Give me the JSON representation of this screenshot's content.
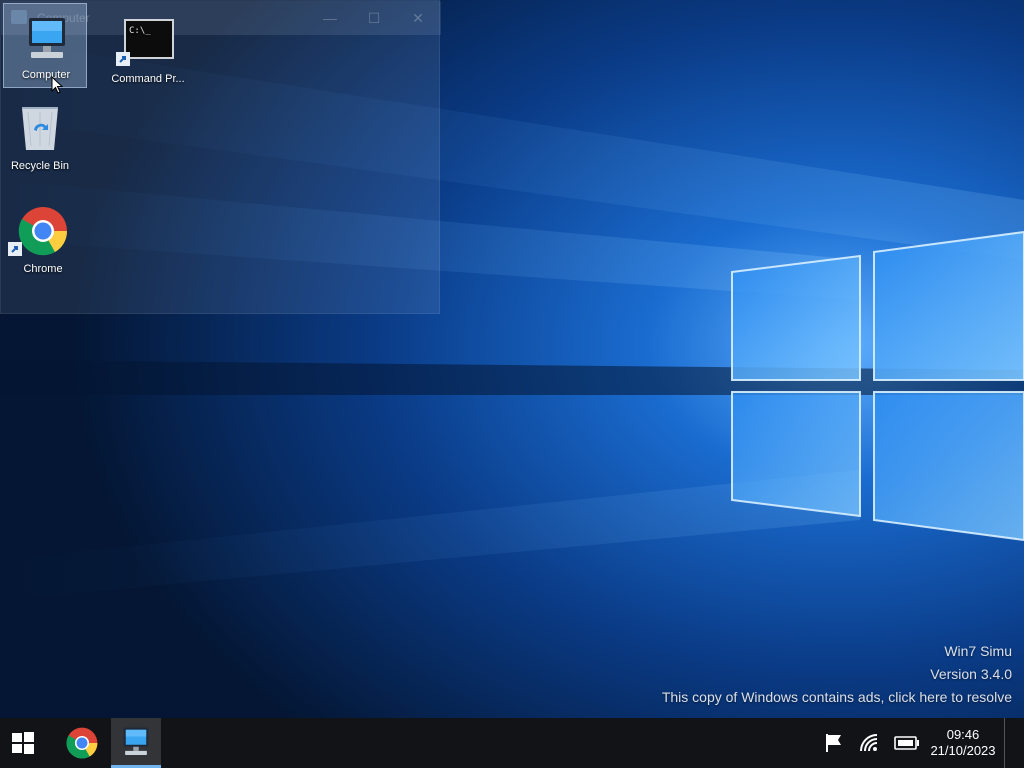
{
  "desktop": {
    "ghost_window": {
      "title": "Computer",
      "minimize": "—",
      "maximize": "☐",
      "close": "✕"
    },
    "icons": [
      {
        "label": "Computer"
      },
      {
        "label": "Command Pr..."
      },
      {
        "label": "Recycle Bin"
      },
      {
        "label": "Chrome"
      }
    ],
    "watermark": {
      "line1": "Win7 Simu",
      "line2": "Version 3.4.0",
      "line3": "This copy of Windows contains ads, click here to resolve"
    },
    "terminal_prompt": "C:\\_"
  },
  "taskbar": {
    "start_icon": "windows-logo-icon",
    "pinned": [
      {
        "icon": "chrome-icon"
      },
      {
        "icon": "computer-icon",
        "active": true
      }
    ],
    "tray": {
      "icons": [
        "flag-icon",
        "wifi-icon",
        "battery-icon"
      ],
      "time": "09:46",
      "date": "21/10/2023"
    }
  },
  "colors": {
    "accent": "#6fb4ee",
    "taskbar": "#111317",
    "wallpaper_dark": "#06214a",
    "wallpaper_light": "#1f7ad6"
  }
}
